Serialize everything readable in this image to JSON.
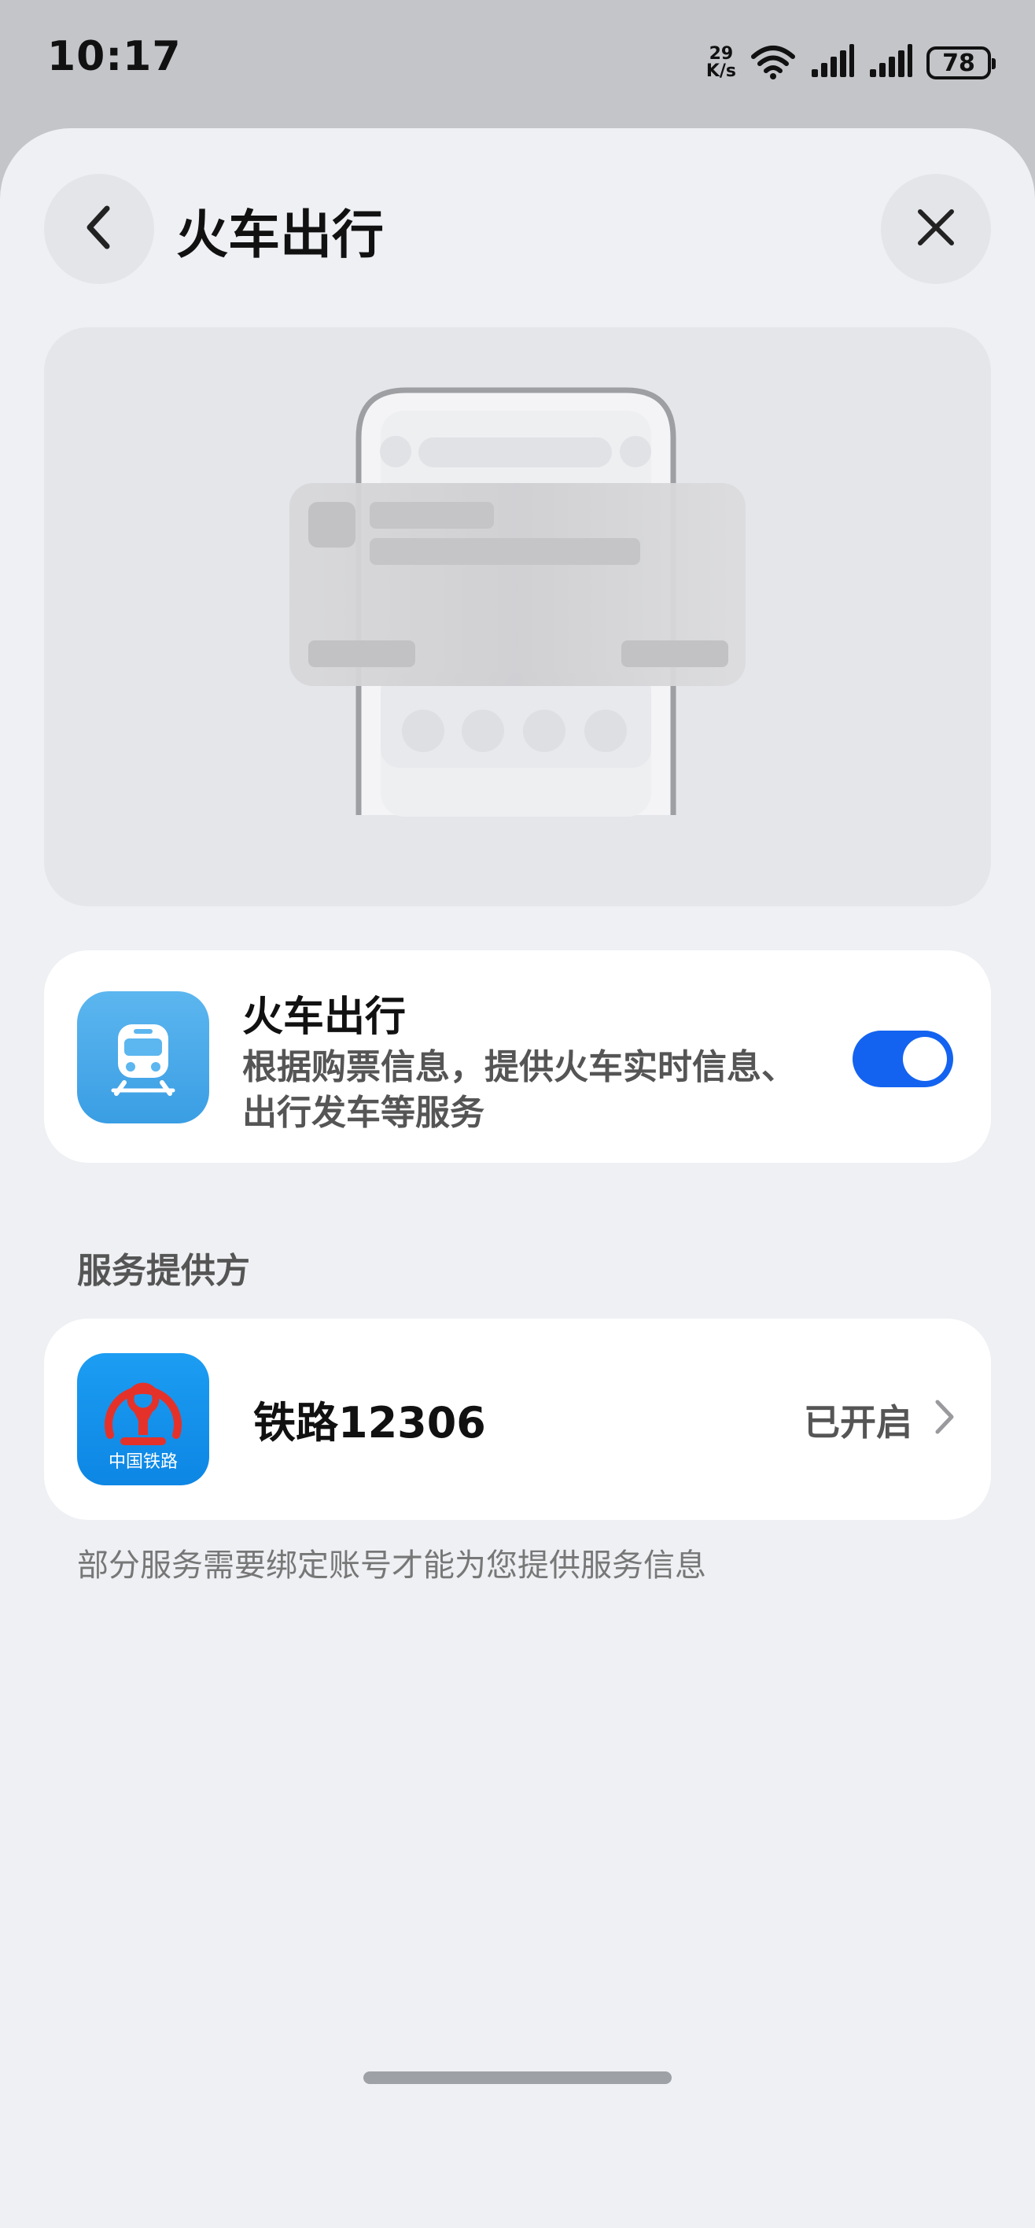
{
  "status_bar": {
    "time": "10:17",
    "net_speed_value": "29",
    "net_speed_unit": "K/s",
    "battery": "78"
  },
  "header": {
    "title": "火车出行"
  },
  "feature": {
    "title": "火车出行",
    "description": "根据购票信息，提供火车实时信息、出行发车等服务",
    "enabled": true
  },
  "section": {
    "provider_label": "服务提供方"
  },
  "provider": {
    "name": "铁路12306",
    "icon_caption": "中国铁路",
    "status": "已开启"
  },
  "footnote": "部分服务需要绑定账号才能为您提供服务信息",
  "colors": {
    "accent": "#1463f0",
    "sheet_background": "#eef0f3",
    "card_background": "#ffffff"
  }
}
